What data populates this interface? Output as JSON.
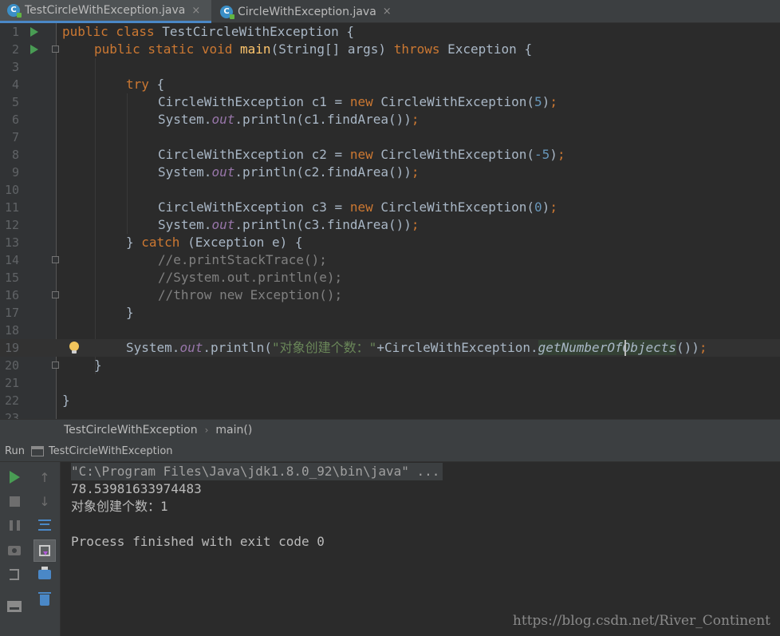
{
  "tabs": [
    {
      "label": "TestCircleWithException.java",
      "icon": "java-class-icon",
      "active": true
    },
    {
      "label": "CircleWithException.java",
      "icon": "java-class-icon",
      "active": false
    }
  ],
  "tab_icon_letter": "C",
  "close_glyph": "×",
  "editor": {
    "lines": [
      "1",
      "2",
      "3",
      "4",
      "5",
      "6",
      "7",
      "8",
      "9",
      "10",
      "11",
      "12",
      "13",
      "14",
      "15",
      "16",
      "17",
      "18",
      "19",
      "20",
      "21",
      "22",
      "23"
    ],
    "code": {
      "l1_kw": "public class ",
      "l1_rest": "TestCircleWithException {",
      "l2_kw": "public static void ",
      "l2_fn": "main",
      "l2_mid": "(String[] args) ",
      "l2_kw2": "throws",
      "l2_rest": " Exception {",
      "l4_kw": "try",
      "l4_rest": " {",
      "l5_a": "CircleWithException c1 = ",
      "l5_new": "new",
      "l5_b": " CircleWithException(",
      "l5_num": "5",
      "l5_c": ")",
      "l5_semi": ";",
      "l6_a": "System.",
      "l6_out": "out",
      "l6_b": ".println(c1.findArea())",
      "l6_semi": ";",
      "l8_a": "CircleWithException c2 = ",
      "l8_new": "new",
      "l8_b": " CircleWithException(",
      "l8_num": "-5",
      "l8_c": ")",
      "l8_semi": ";",
      "l9_a": "System.",
      "l9_out": "out",
      "l9_b": ".println(c2.findArea())",
      "l9_semi": ";",
      "l11_a": "CircleWithException c3 = ",
      "l11_new": "new",
      "l11_b": " CircleWithException(",
      "l11_num": "0",
      "l11_c": ")",
      "l11_semi": ";",
      "l12_a": "System.",
      "l12_out": "out",
      "l12_b": ".println(c3.findArea())",
      "l12_semi": ";",
      "l13_a": "} ",
      "l13_kw": "catch",
      "l13_b": " (Exception e) {",
      "l14": "//e.printStackTrace();",
      "l15": "//System.out.println(e);",
      "l16": "//throw new Exception();",
      "l17": "}",
      "l19_a": "System.",
      "l19_out": "out",
      "l19_b": ".println(",
      "l19_str": "\"对象创建个数：\"",
      "l19_c": "+CircleWithException.",
      "l19_m": "getNumberOfObjects",
      "l19_d": "())",
      "l19_semi": ";",
      "l20": "}",
      "l22": "}"
    }
  },
  "breadcrumb": {
    "items": [
      "TestCircleWithException",
      "main()"
    ],
    "separator": "›"
  },
  "run_panel": {
    "title": "Run",
    "config": "TestCircleWithException",
    "console": [
      "\"C:\\Program Files\\Java\\jdk1.8.0_92\\bin\\java\" ...",
      "78.53981633974483",
      "对象创建个数：1",
      "",
      "Process finished with exit code 0"
    ]
  },
  "watermark": "https://blog.csdn.net/River_Continent",
  "colors": {
    "keyword": "#cc7832",
    "number": "#6897bb",
    "string": "#6a8759",
    "comment": "#808080",
    "static_field": "#9876aa",
    "method_decl": "#ffc66d",
    "accent": "#4a88c7"
  }
}
